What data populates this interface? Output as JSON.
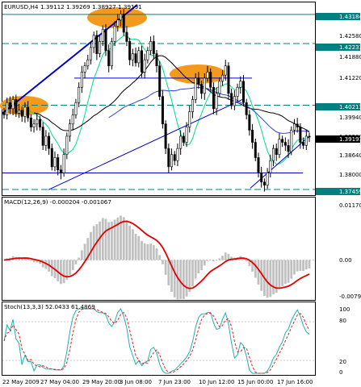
{
  "chart_header": {
    "symbol": "EURUSD,H4",
    "ohlc": "1.39112 1.39269 1.38927 1.39191"
  },
  "macd_header": "MACD(12,26,9) -0.000204 -0.001067",
  "stoch_header": "Stoch(13,3,3) 52.0433 61.4869",
  "price_axis": {
    "ticks": [
      "1.43184",
      "1.42580",
      "1.42231",
      "1.41880",
      "1.41220",
      "1.40213",
      "1.39940",
      "1.39280",
      "1.38640",
      "1.38000",
      "1.37459"
    ],
    "current_price": "1.39191",
    "highlight_levels": [
      "1.43184",
      "1.42231",
      "1.40213",
      "1.37459"
    ]
  },
  "macd_axis": {
    "ticks": [
      "0.01170",
      "0.00",
      "-0.00791"
    ]
  },
  "stoch_axis": {
    "ticks": [
      "100",
      "80",
      "20",
      "0"
    ]
  },
  "time_axis": {
    "labels": [
      "22 May 2009",
      "27 May 04:00",
      "29 May 20:00",
      "3 Jun 08:00",
      "7 Jun 23:00",
      "10 Jun 12:00",
      "15 Jun 00:00",
      "17 Jun 16:00"
    ]
  },
  "colors": {
    "candle": "#000000",
    "trendline": "#0000cc",
    "level_line": "#008080",
    "highlight": "#f39a1e",
    "ma_fast": "#00dd88",
    "ma_slow": "#000000",
    "ma_blue": "#3344dd",
    "macd_hist": "#c0c0c0",
    "macd_signal": "#e00000",
    "stoch_main": "#20b0b0",
    "stoch_signal": "#e02020"
  },
  "chart_data": [
    {
      "type": "candlestick",
      "title": "EURUSD,H4",
      "ylim": [
        1.373,
        1.4355
      ],
      "close": [
        1.399,
        1.403,
        1.401,
        1.404,
        1.3995,
        1.4005,
        1.3985,
        1.4015,
        1.398,
        1.395,
        1.396,
        1.3975,
        1.395,
        1.389,
        1.392,
        1.388,
        1.382,
        1.385,
        1.381,
        1.38,
        1.386,
        1.392,
        1.396,
        1.399,
        1.403,
        1.408,
        1.413,
        1.415,
        1.417,
        1.421,
        1.425,
        1.419,
        1.423,
        1.427,
        1.42,
        1.415,
        1.423,
        1.428,
        1.43,
        1.432,
        1.426,
        1.423,
        1.417,
        1.419,
        1.416,
        1.42,
        1.413,
        1.417,
        1.42,
        1.423,
        1.419,
        1.415,
        1.405,
        1.396,
        1.388,
        1.382,
        1.386,
        1.384,
        1.388,
        1.392,
        1.39,
        1.395,
        1.4,
        1.404,
        1.411,
        1.409,
        1.406,
        1.411,
        1.413,
        1.408,
        1.401,
        1.406,
        1.41,
        1.412,
        1.415,
        1.406,
        1.402,
        1.405,
        1.408,
        1.41,
        1.403,
        1.399,
        1.394,
        1.39,
        1.385,
        1.38,
        1.377,
        1.376,
        1.38,
        1.384,
        1.388,
        1.386,
        1.391,
        1.39,
        1.389,
        1.387,
        1.394,
        1.396,
        1.395,
        1.39,
        1.389,
        1.392,
        1.3919
      ],
      "series": [
        {
          "name": "MACD(12,26,9)",
          "main": -0.000204,
          "signal": -0.001067
        },
        {
          "name": "Stoch(13,3,3)",
          "main": 52.0433,
          "signal": 61.4869
        }
      ]
    }
  ]
}
